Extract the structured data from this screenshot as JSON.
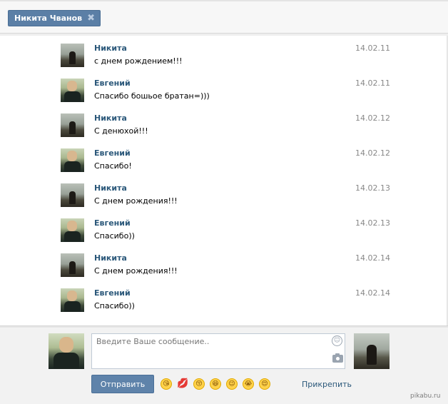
{
  "chat_tab": {
    "name": "Никита Чванов",
    "close": "✖"
  },
  "messages": [
    {
      "author": "Никита",
      "text": "с днем рождением!!!",
      "date": "14.02.11",
      "avatar": "nikita"
    },
    {
      "author": "Евгений",
      "text": "Спасибо бошьое братан=)))",
      "date": "14.02.11",
      "avatar": "evgeny"
    },
    {
      "author": "Никита",
      "text": "С денюхой!!!",
      "date": "14.02.12",
      "avatar": "nikita"
    },
    {
      "author": "Евгений",
      "text": "Спасибо!",
      "date": "14.02.12",
      "avatar": "evgeny"
    },
    {
      "author": "Никита",
      "text": "С днем рождения!!!",
      "date": "14.02.13",
      "avatar": "nikita"
    },
    {
      "author": "Евгений",
      "text": "Спасибо))",
      "date": "14.02.13",
      "avatar": "evgeny"
    },
    {
      "author": "Никита",
      "text": "С днем рождения!!!",
      "date": "14.02.14",
      "avatar": "nikita"
    },
    {
      "author": "Евгений",
      "text": "Спасибо))",
      "date": "14.02.14",
      "avatar": "evgeny"
    }
  ],
  "composer": {
    "placeholder": "Введите Ваше сообщение..",
    "send_label": "Отправить",
    "attach_label": "Прикрепить",
    "emoji": [
      "😘",
      "💋",
      "😚",
      "😆",
      "😉",
      "😭",
      "😌"
    ]
  },
  "watermark": "pikabu.ru",
  "colors": {
    "accent": "#5b7fa6",
    "author_link": "#2b587a",
    "date_gray": "#888888"
  },
  "icons": [
    "close-icon",
    "smiley-icon",
    "camera-icon"
  ]
}
